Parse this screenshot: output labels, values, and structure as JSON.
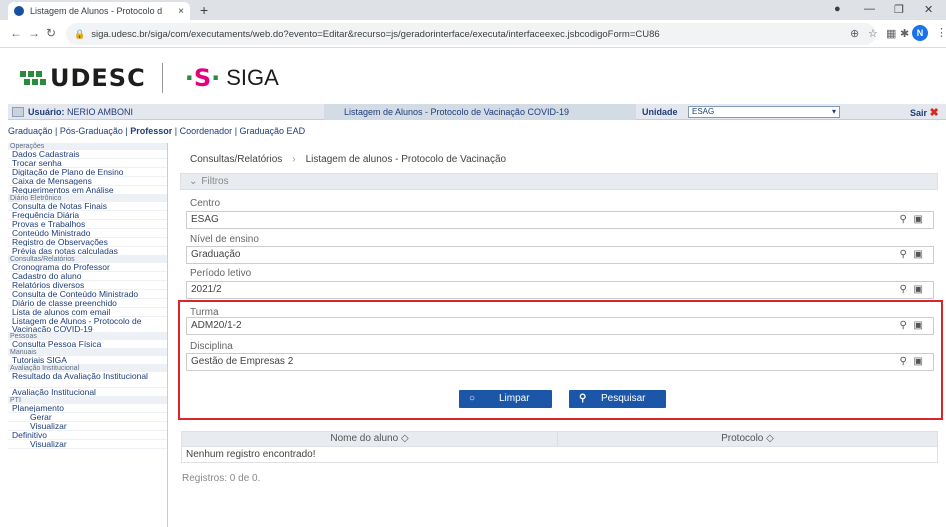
{
  "browser": {
    "tab_title": "Listagem de Alunos - Protocolo d",
    "tab_close": "×",
    "new_tab": "+",
    "url": "siga.udesc.br/siga/com/executaments/web.do?evento=Editar&recurso=js/geradorinterface/executa/interfaceexec.jsbcodigoForm=CU86",
    "profile_initial": "N"
  },
  "logo": {
    "udesc": "UDESC",
    "siga": "SIGA"
  },
  "header": {
    "user_label": "Usuário:",
    "user_name": "NERIO AMBONI",
    "page_title": "Listagem de Alunos - Protocolo de Vacinação COVID-19",
    "unidade_label": "Unidade",
    "unidade_value": "ESAG",
    "sair": "Sair"
  },
  "gradbar": {
    "graduacao": "Graduação",
    "pos": "Pós-Graduação",
    "professor": "Professor",
    "coordenador": "Coordenador",
    "ead": "Graduação EAD",
    "sep": " | "
  },
  "sidebar": {
    "sections": [
      {
        "title": "Operações",
        "items": [
          "Dados Cadastrais",
          "Trocar senha",
          "Digitação de Plano de Ensino",
          "Caixa de Mensagens",
          "Requerimentos em Análise"
        ]
      },
      {
        "title": "Diário Eletrônico",
        "items": [
          "Consulta de Notas Finais",
          "Frequência Diária",
          "Provas e Trabalhos",
          "Conteúdo Ministrado",
          "Registro de Observações",
          "Prévia das notas calculadas"
        ]
      },
      {
        "title": "Consultas/Relatórios",
        "items": [
          "Cronograma do Professor",
          "Cadastro do aluno",
          "Relatórios diversos",
          "Consulta de Conteúdo Ministrado",
          "Diário de classe preenchido",
          "Lista de alunos com email",
          "Listagem de Alunos - Protocolo de Vacinação COVID-19"
        ]
      },
      {
        "title": "Pessoas",
        "items": [
          "Consulta Pessoa Física"
        ]
      },
      {
        "title": "Manuais",
        "items": [
          "Tutoriais SIGA"
        ]
      },
      {
        "title": "Avaliação Institucional",
        "items": [
          "Resultado da Avaliação Institucional",
          "Avaliação Institucional"
        ]
      },
      {
        "title": "PTI",
        "items": [
          "Planejamento",
          "Gerar",
          "Visualizar"
        ]
      },
      {
        "title": "",
        "items": [
          "Definitivo",
          "Visualizar"
        ]
      }
    ]
  },
  "main": {
    "breadcrumb_root": "Consultas/Relatórios",
    "breadcrumb_current": "Listagem de alunos - Protocolo de Vacinação",
    "filters_label": "Filtros",
    "fields": {
      "centro": {
        "label": "Centro",
        "value": "ESAG"
      },
      "nivel": {
        "label": "Nível de ensino",
        "value": "Graduação"
      },
      "periodo": {
        "label": "Período letivo",
        "value": "2021/2"
      },
      "turma": {
        "label": "Turma",
        "value": "ADM20/1-2"
      },
      "disciplina": {
        "label": "Disciplina",
        "value": "Gestão de Empresas 2"
      }
    },
    "btn_limpar": "Limpar",
    "btn_pesquisar": "Pesquisar",
    "col_nome": "Nome do aluno",
    "col_protocolo": "Protocolo",
    "empty": "Nenhum registro encontrado!",
    "count": "Registros: 0 de 0."
  },
  "colors": {
    "accent_blue": "#1c56a8",
    "highlight_red": "#d7262c",
    "udesc_green": "#2a8a3e",
    "siga_magenta": "#e6007e"
  }
}
